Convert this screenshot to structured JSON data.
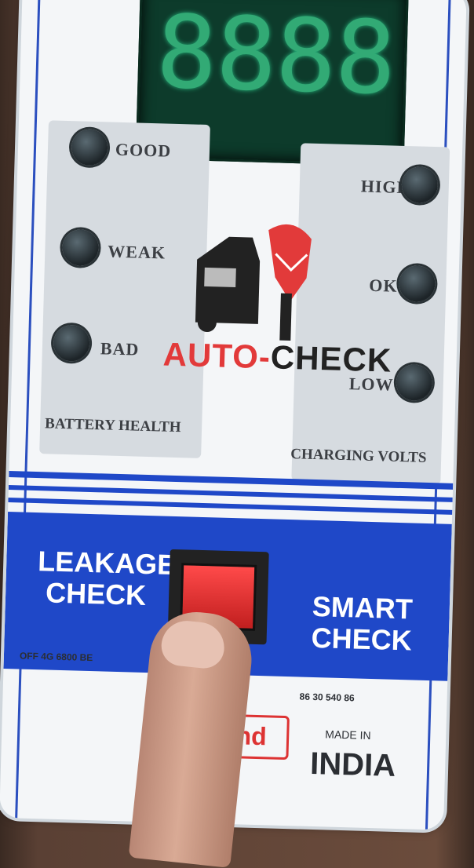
{
  "display": {
    "digits": [
      "8",
      "8",
      "8",
      "8"
    ]
  },
  "battery": {
    "good": "GOOD",
    "weak": "WEAK",
    "bad": "BAD",
    "section_label": "BATTERY HEALTH"
  },
  "charging": {
    "high": "HIGH",
    "ok": "OK",
    "low": "LOW",
    "section_label": "CHARGING VOLTS"
  },
  "brand": {
    "part1": "AUTO-",
    "part2": "CHECK"
  },
  "buttons": {
    "leakage_line1": "LEAKAGE",
    "leakage_line2": "CHECK",
    "smart_line1": "SMART",
    "smart_line2": "CHECK"
  },
  "footer": {
    "left_code": "OFF 4G 6800 BE",
    "right_code": "86 30 540 86",
    "made_in": "MADE IN",
    "country": "INDIA",
    "logo_text": "nd"
  },
  "colors": {
    "accent_blue": "#1f48c8",
    "brand_red": "#e23a3a",
    "led_green": "#3fd08e"
  }
}
